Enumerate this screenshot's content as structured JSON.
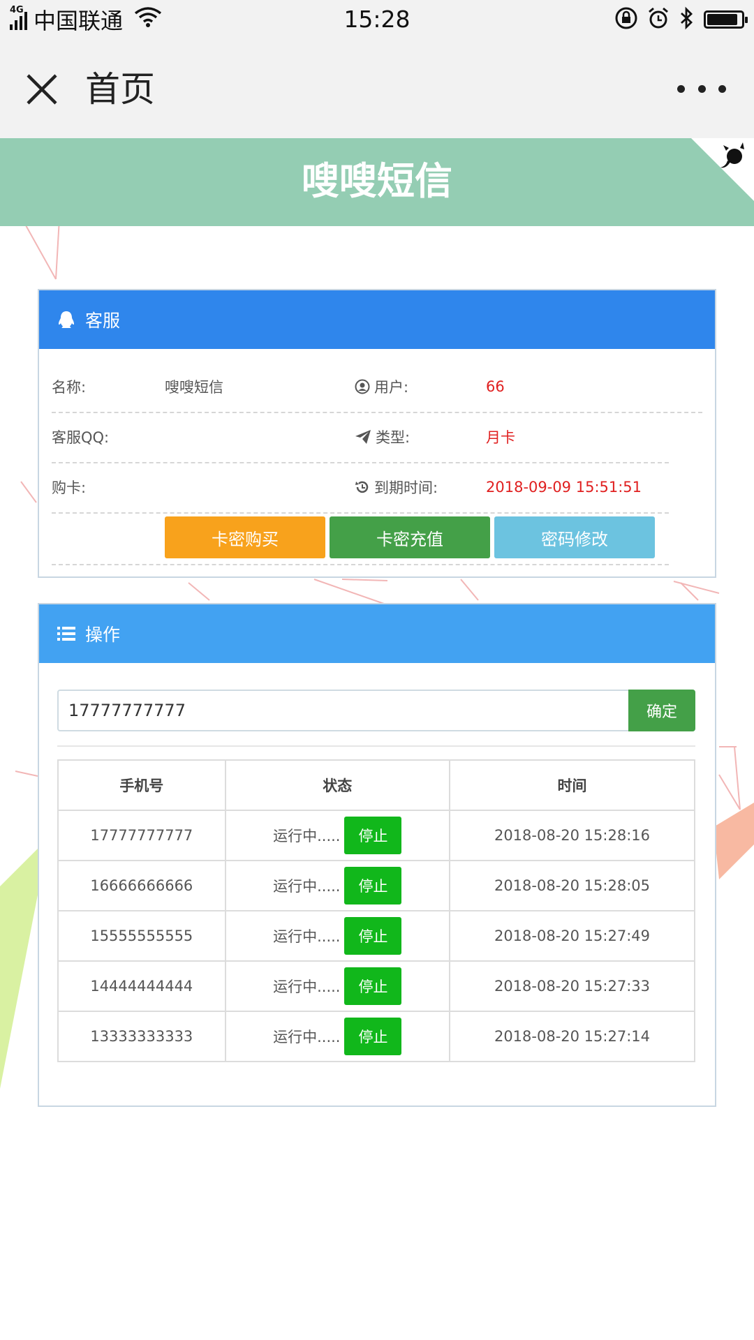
{
  "status_bar": {
    "network": "4G",
    "carrier": "中国联通",
    "time": "15:28"
  },
  "nav": {
    "title": "首页"
  },
  "header": {
    "title": "嗖嗖短信"
  },
  "service_panel": {
    "title": "客服",
    "rows": [
      {
        "label": "名称:",
        "value": "嗖嗖短信",
        "label2": "用户:",
        "value2": "66"
      },
      {
        "label": "客服QQ:",
        "value": "",
        "label2": "类型:",
        "value2": "月卡"
      },
      {
        "label": "购卡:",
        "value": "",
        "label2": "到期时间:",
        "value2": "2018-09-09 15:51:51"
      }
    ],
    "buttons": {
      "buy": "卡密购买",
      "recharge": "卡密充值",
      "password": "密码修改"
    },
    "colors": {
      "buy": "#f8a21c",
      "recharge": "#44a048",
      "password": "#6cc3e0"
    }
  },
  "operation_panel": {
    "title": "操作",
    "phone_input_value": "17777777777",
    "confirm_label": "确定",
    "table": {
      "headers": [
        "手机号",
        "状态",
        "时间"
      ],
      "rows": [
        {
          "phone": "17777777777",
          "status": "运行中.....",
          "action": "停止",
          "time": "2018-08-20 15:28:16"
        },
        {
          "phone": "16666666666",
          "status": "运行中.....",
          "action": "停止",
          "time": "2018-08-20 15:28:05"
        },
        {
          "phone": "15555555555",
          "status": "运行中.....",
          "action": "停止",
          "time": "2018-08-20 15:27:49"
        },
        {
          "phone": "14444444444",
          "status": "运行中.....",
          "action": "停止",
          "time": "2018-08-20 15:27:33"
        },
        {
          "phone": "13333333333",
          "status": "运行中.....",
          "action": "停止",
          "time": "2018-08-20 15:27:14"
        }
      ]
    }
  },
  "battery_level": 0.9,
  "theme": {
    "header_band": "#94cdb3",
    "panel1_head": "#2f86ec",
    "panel2_head": "#42a2f2",
    "expire_red": "#e02020"
  }
}
